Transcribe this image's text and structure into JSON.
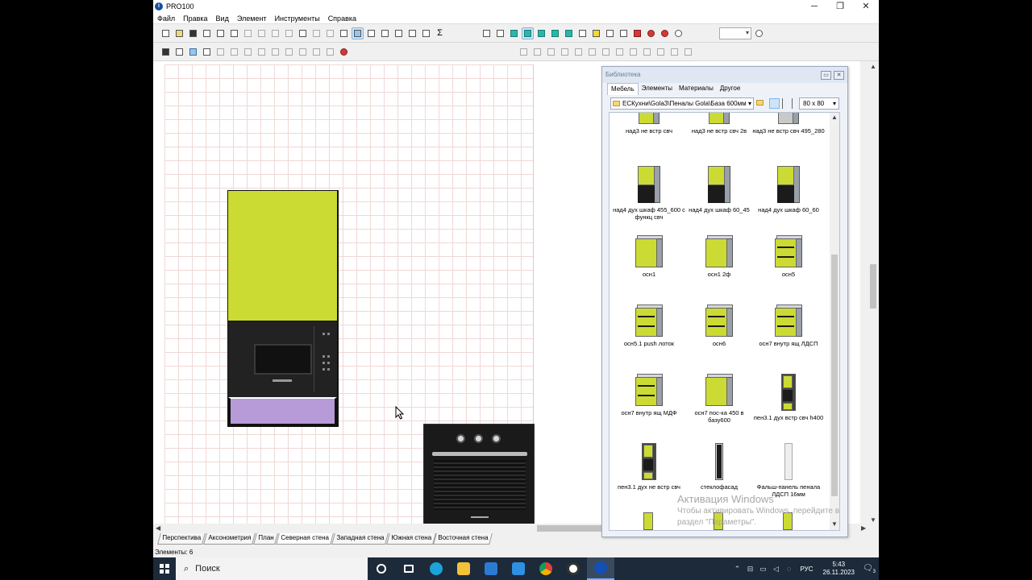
{
  "window": {
    "title": "PRO100",
    "minimize": "─",
    "maximize": "❐",
    "close": "✕"
  },
  "menu": [
    "Файл",
    "Правка",
    "Вид",
    "Элемент",
    "Инструменты",
    "Справка"
  ],
  "toolbar": {
    "zoom_value": ""
  },
  "view_tabs": [
    "Перспектива",
    "Аксонометрия",
    "План",
    "Северная стена",
    "Западная стена",
    "Южная стена",
    "Восточная стена"
  ],
  "active_view_tab": "Северная стена",
  "status": {
    "elements": "Элементы: 6"
  },
  "library": {
    "title": "Библиотека",
    "tabs": [
      "Мебель",
      "Элементы",
      "Материалы",
      "Другое"
    ],
    "active_tab": "Мебель",
    "path": "ЕСКухни\\Gola3\\Пеналы Gola\\База 600мм",
    "thumb_size": "80 x 80",
    "items": [
      {
        "label": "над3 не встр свч",
        "kind": "upper"
      },
      {
        "label": "над3 не встр свч 2в",
        "kind": "upper"
      },
      {
        "label": "над3 не встр свч 495_280",
        "kind": "upper-gray"
      },
      {
        "label": "над4 дух шкаф 455_600 с функц свч",
        "kind": "tall-dark"
      },
      {
        "label": "над4 дух шкаф 60_45",
        "kind": "tall-dark"
      },
      {
        "label": "над4 дух шкаф 60_60",
        "kind": "tall-dark"
      },
      {
        "label": "осн1",
        "kind": "base"
      },
      {
        "label": "осн1 2ф",
        "kind": "base"
      },
      {
        "label": "осн5",
        "kind": "base-open"
      },
      {
        "label": "осн5.1 push лоток",
        "kind": "base-open"
      },
      {
        "label": "осн6",
        "kind": "base-open"
      },
      {
        "label": "осн7 внутр ящ ЛДСП",
        "kind": "base-open"
      },
      {
        "label": "осн7 внутр ящ МДФ",
        "kind": "base-open"
      },
      {
        "label": "осн7 пос-ка 450 в базу600",
        "kind": "base"
      },
      {
        "label": "пен3.1 дух встр свч h400",
        "kind": "pen"
      },
      {
        "label": "пен3.1 дух не встр свч",
        "kind": "pen"
      },
      {
        "label": "стеклофасад",
        "kind": "glass"
      },
      {
        "label": "Фальш-панель пенала ЛДСП 16мм",
        "kind": "panel"
      }
    ]
  },
  "watermark": {
    "line1": "Активация Windows",
    "line2": "Чтобы активировать Windows, перейдите в",
    "line3": "раздел \"Параметры\"."
  },
  "taskbar": {
    "search_placeholder": "Поиск",
    "time": "5:43",
    "date": "26.11.2023",
    "lang": "РУС",
    "notifications": "3"
  },
  "colors": {
    "facade": "#ccdb33",
    "drawer": "#b79ad8",
    "appliance": "#1a1a1a"
  }
}
